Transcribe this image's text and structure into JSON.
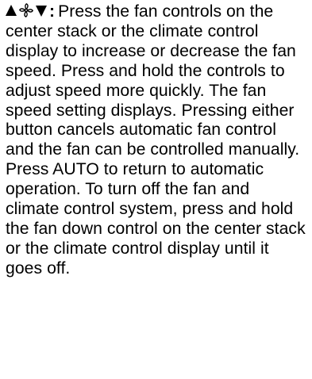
{
  "document": {
    "lead_separator": ":",
    "body_text": "Press the fan controls on the center stack or the climate control display to increase or decrease the fan speed. Press and hold the controls to adjust speed more quickly. The fan speed setting displays. Pressing either button cancels automatic fan control and the fan can be controlled manually. Press AUTO to return to automatic operation. To turn off the fan and climate control system, press and hold the fan down control on the center stack or the climate control display until it goes off.",
    "icons": [
      "fan-up-arrow",
      "fan-icon",
      "fan-down-arrow"
    ]
  }
}
